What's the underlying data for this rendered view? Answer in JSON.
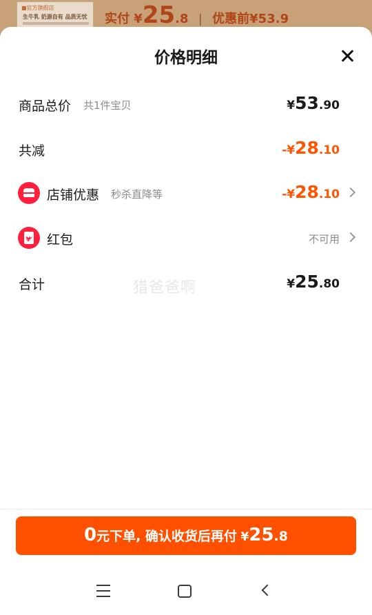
{
  "background": {
    "thumbnail_tag": "■官方旗舰店",
    "thumbnail_text": "生牛乳 奶源自有 品质无忧",
    "price_label": "实付",
    "price_currency": "¥",
    "price_int": "25",
    "price_dec": ".8",
    "before_label": "优惠前",
    "before_price": "¥53.9"
  },
  "sheet": {
    "title": "价格明细",
    "close_icon": "close-icon"
  },
  "rows": {
    "total": {
      "label": "商品总价",
      "sub": "共1件宝贝",
      "cur": "¥",
      "int": "53",
      "dec": ".90"
    },
    "reduce": {
      "label": "共减",
      "cur": "-¥",
      "int": "28",
      "dec": ".10"
    },
    "store_discount": {
      "label": "店铺优惠",
      "sub": "秒杀直降等",
      "cur": "-¥",
      "int": "28",
      "dec": ".10",
      "icon": "store-icon"
    },
    "red_packet": {
      "label": "红包",
      "status": "不可用",
      "icon": "red-packet-icon"
    },
    "sum": {
      "label": "合计",
      "cur": "¥",
      "int": "25",
      "dec": ".80"
    }
  },
  "watermark": "猎爸爸啊",
  "cta": {
    "zero": "0",
    "text": "元下单, 确认收货后再付",
    "cur": "¥",
    "int": "25",
    "dec": ".8"
  },
  "colors": {
    "accent": "#ff5000",
    "discount": "#ff5500",
    "icon_red": "#ff1f3d",
    "muted": "#8c8c8c"
  }
}
